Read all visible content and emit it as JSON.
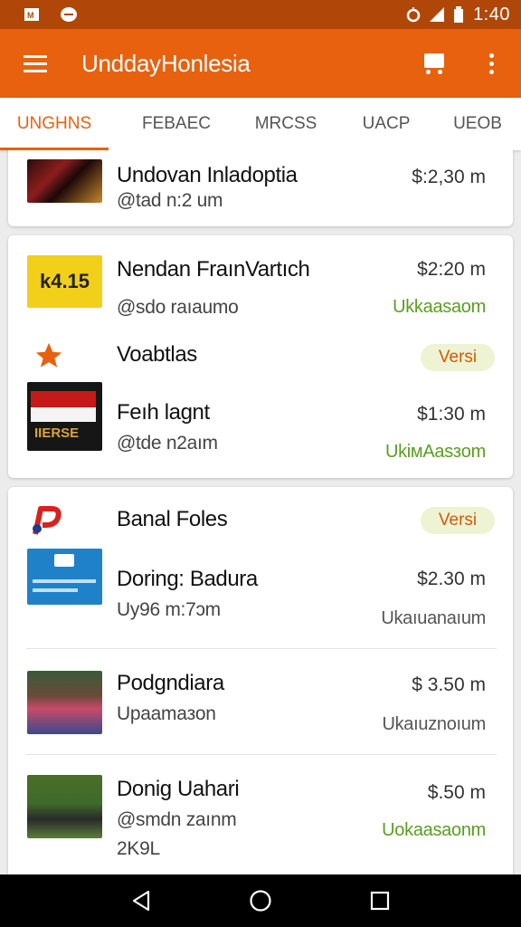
{
  "status_bar": {
    "time": "1:40",
    "icons": [
      "notification-icon",
      "chat-icon",
      "alarm-icon",
      "signal-icon",
      "battery-icon"
    ]
  },
  "app_bar": {
    "title": "UnddayHonlesia",
    "icons": [
      "menu-icon",
      "cart-icon",
      "more-icon"
    ]
  },
  "tabs": [
    {
      "label": "UNGHNS",
      "active": true
    },
    {
      "label": "FEBAEC",
      "active": false
    },
    {
      "label": "MRCSS",
      "active": false
    },
    {
      "label": "UACP",
      "active": false
    },
    {
      "label": "UEOB",
      "active": false
    }
  ],
  "cards": [
    {
      "items": [
        {
          "title": "Undovan Inladoptia",
          "subtitle": "@tad n:2 um",
          "price": "$:2,30 m",
          "status": ""
        }
      ]
    },
    {
      "items": [
        {
          "title": "Nendan FraınVartıch",
          "subtitle": "@sdo raıaumo",
          "price": "$2:20 m",
          "status": "Ukkaasaom",
          "thumb_text": "k4.15"
        },
        {
          "title": "Voabtlas",
          "badge": "Versi",
          "icon": "star-icon"
        },
        {
          "title": "Feıh lagnt",
          "subtitle": "@tde n2aım",
          "price": "$1:30 m",
          "status": "UkiмAasзom",
          "thumb_text": "IIERSE"
        }
      ]
    },
    {
      "items": [
        {
          "title": "Banal Foles",
          "badge": "Versi",
          "icon": "brand-p-icon"
        },
        {
          "title": "Doring: Badura",
          "subtitle": "Uy96 m:7ɔm",
          "price": "$2.30 m",
          "status": "Ukaıuanaıum"
        },
        {
          "title": "Podgndiara",
          "subtitle": "Upaamaзon",
          "price": "$ 3.50 m",
          "status": "Ukaıuznoıum"
        },
        {
          "title": "Donig Uahari",
          "subtitle": "@smdn zaınm",
          "extra": "2K9L",
          "price": "$.50 m",
          "status": "Uokaasaonm"
        }
      ]
    }
  ],
  "nav_bar": {
    "icons": [
      "back-icon",
      "home-icon",
      "recents-icon"
    ]
  },
  "colors": {
    "primary": "#e8610e",
    "status_bar": "#b04708",
    "green_status": "#5a9e1f",
    "badge_bg": "#eef3d3"
  }
}
